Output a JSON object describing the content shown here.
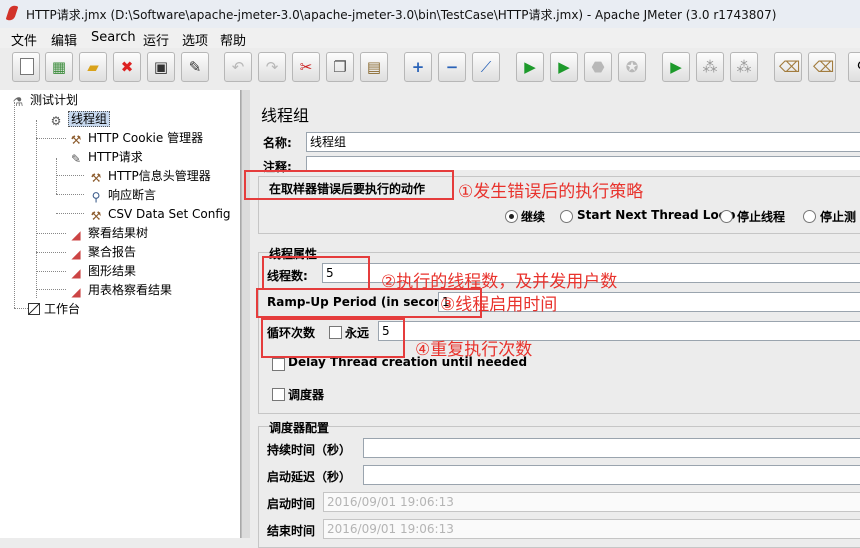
{
  "window": {
    "title": "HTTP请求.jmx (D:\\Software\\apache-jmeter-3.0\\apache-jmeter-3.0\\bin\\TestCase\\HTTP请求.jmx) - Apache JMeter (3.0 r1743807)"
  },
  "menu": [
    "文件",
    "编辑",
    "Search",
    "运行",
    "选项",
    "帮助"
  ],
  "toolbar": [
    {
      "icon": "new-icon"
    },
    {
      "icon": "templates-icon"
    },
    {
      "icon": "open-icon"
    },
    {
      "icon": "close-icon"
    },
    {
      "icon": "save-icon"
    },
    {
      "icon": "save-as-icon"
    },
    {
      "icon": "undo-icon",
      "disabled": true
    },
    {
      "icon": "redo-icon",
      "disabled": true
    },
    {
      "icon": "cut-icon"
    },
    {
      "icon": "copy-icon"
    },
    {
      "icon": "paste-icon"
    },
    {
      "icon": "expand-icon"
    },
    {
      "icon": "collapse-icon"
    },
    {
      "icon": "toggle-icon"
    },
    {
      "icon": "start-icon"
    },
    {
      "icon": "start-no-pause-icon"
    },
    {
      "icon": "stop-icon",
      "disabled": true
    },
    {
      "icon": "shutdown-icon",
      "disabled": true
    },
    {
      "icon": "remote-start-icon"
    },
    {
      "icon": "remote-stop-icon"
    },
    {
      "icon": "remote-exit-icon"
    },
    {
      "icon": "clear-icon"
    },
    {
      "icon": "clear-all-icon"
    },
    {
      "icon": "search-icon"
    }
  ],
  "tree": {
    "test_plan": "测试计划",
    "thread_group": "线程组",
    "cookie_manager": "HTTP Cookie 管理器",
    "http_request": "HTTP请求",
    "header_manager": "HTTP信息头管理器",
    "response_assertion": "响应断言",
    "csv_config": "CSV Data Set Config",
    "view_results_tree": "察看结果树",
    "aggregate_report": "聚合报告",
    "graph_results": "图形结果",
    "table_results": "用表格察看结果",
    "workbench": "工作台"
  },
  "panel": {
    "heading": "线程组",
    "name_label": "名称:",
    "name_value": "线程组",
    "comment_label": "注释:",
    "error_action_title": "在取样器错误后要执行的动作",
    "error_options": [
      "继续",
      "Start Next Thread Loop",
      "停止线程",
      "停止测"
    ],
    "props_title": "线程属性",
    "threads_label": "线程数:",
    "threads_value": "5",
    "rampup_label": "Ramp-Up Period (in seconds):",
    "rampup_value": "1",
    "loop_label": "循环次数",
    "forever_label": "永远",
    "loop_value": "5",
    "delay_label": "Delay Thread creation until needed",
    "scheduler_label": "调度器",
    "sched_title": "调度器配置",
    "duration_label": "持续时间（秒）",
    "startup_delay_label": "启动延迟（秒）",
    "start_time_label": "启动时间",
    "start_time_value": "2016/09/01 19:06:13",
    "end_time_label": "结束时间",
    "end_time_value": "2016/09/01 19:06:13"
  },
  "annotations": {
    "a1": "①发生错误后的执行策略",
    "a2": "②执行的线程数，及并发用户数",
    "a3": "③线程启用时间",
    "a4": "④重复执行次数",
    "color": "#e53c3c"
  }
}
